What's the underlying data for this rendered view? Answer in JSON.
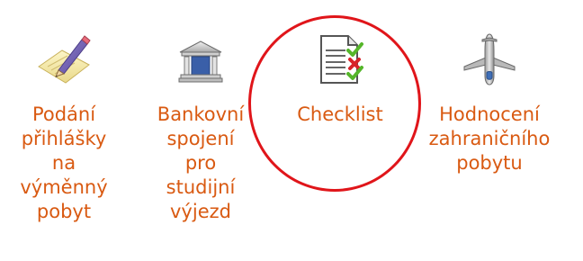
{
  "menu": {
    "items": [
      {
        "label": "Podání\npřihlášky\nna\nvýměnný\npobyt",
        "icon": "pencil-paper-icon"
      },
      {
        "label": "Bankovní\nspojení\npro\nstudijní\nvýjezd",
        "icon": "bank-building-icon"
      },
      {
        "label": "Checklist",
        "icon": "checklist-icon"
      },
      {
        "label": "Hodnocení\nzahraničního\npobytu",
        "icon": "airplane-icon"
      }
    ]
  },
  "colors": {
    "label": "#d95a12",
    "highlight": "#e0151a",
    "check": "#55b62a",
    "cross": "#d8232a"
  }
}
